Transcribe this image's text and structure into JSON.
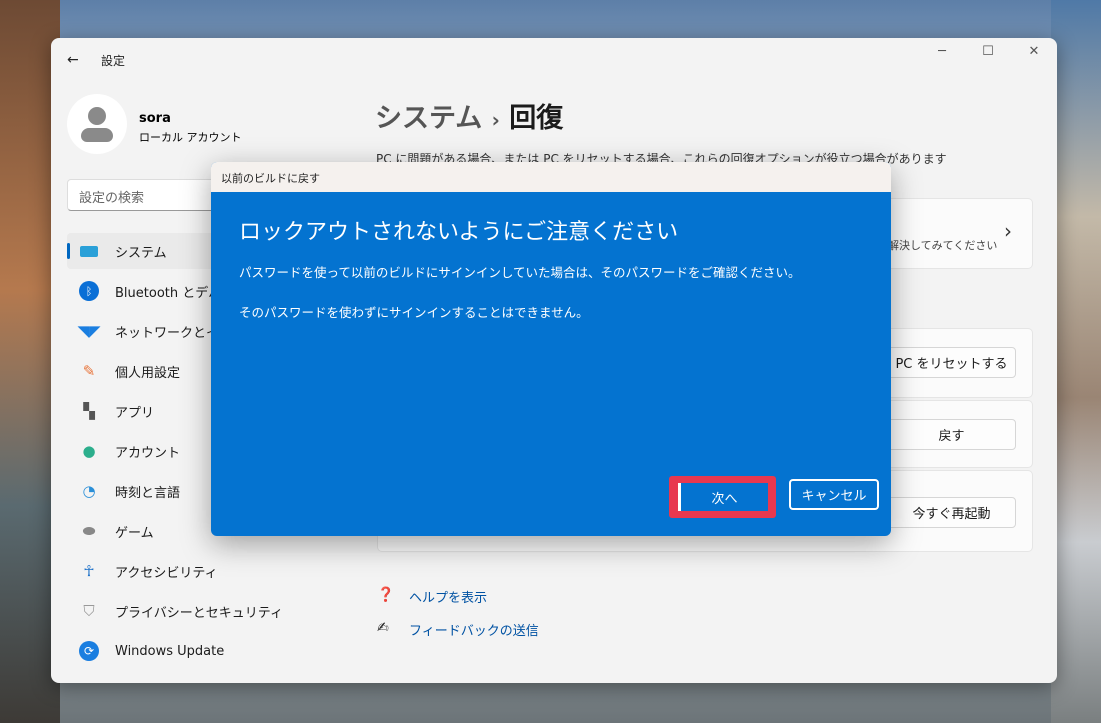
{
  "window": {
    "title": "設定",
    "back": "←",
    "minimize": "─",
    "maximize": "☐",
    "close": "✕"
  },
  "user": {
    "name": "sora",
    "type": "ローカル アカウント"
  },
  "search": {
    "placeholder": "設定の検索"
  },
  "sidebar": {
    "items": [
      {
        "label": "システム",
        "icon": "system-icon"
      },
      {
        "label": "Bluetooth とデバイス",
        "icon": "bluetooth-icon"
      },
      {
        "label": "ネットワークとインターネット",
        "icon": "wifi-icon"
      },
      {
        "label": "個人用設定",
        "icon": "brush-icon"
      },
      {
        "label": "アプリ",
        "icon": "apps-icon"
      },
      {
        "label": "アカウント",
        "icon": "account-icon"
      },
      {
        "label": "時刻と言語",
        "icon": "time-language-icon"
      },
      {
        "label": "ゲーム",
        "icon": "gamepad-icon"
      },
      {
        "label": "アクセシビリティ",
        "icon": "accessibility-icon"
      },
      {
        "label": "プライバシーとセキュリティ",
        "icon": "shield-icon"
      },
      {
        "label": "Windows Update",
        "icon": "update-icon"
      }
    ]
  },
  "main": {
    "breadcrumb_parent": "システム",
    "separator": "›",
    "title": "回復",
    "description": "PC に問題がある場合、または PC をリセットする場合、これらの回復オプションが役立つ場合があります",
    "troubleshoot_text": "解決してみてください",
    "chevron": "›",
    "reset_button": "PC をリセットする",
    "goback_button": "戻す",
    "restart_button": "今すぐ再起動",
    "help_link": "ヘルプを表示",
    "feedback_link": "フィードバックの送信"
  },
  "dialog": {
    "title": "以前のビルドに戻す",
    "heading": "ロックアウトされないようにご注意ください",
    "line1": "パスワードを使って以前のビルドにサインインしていた場合は、そのパスワードをご確認ください。",
    "line2": "そのパスワードを使わずにサインインすることはできません。",
    "next": "次へ",
    "cancel": "キャンセル",
    "highlight_color": "#e8384f",
    "accent": "#0473d0"
  }
}
